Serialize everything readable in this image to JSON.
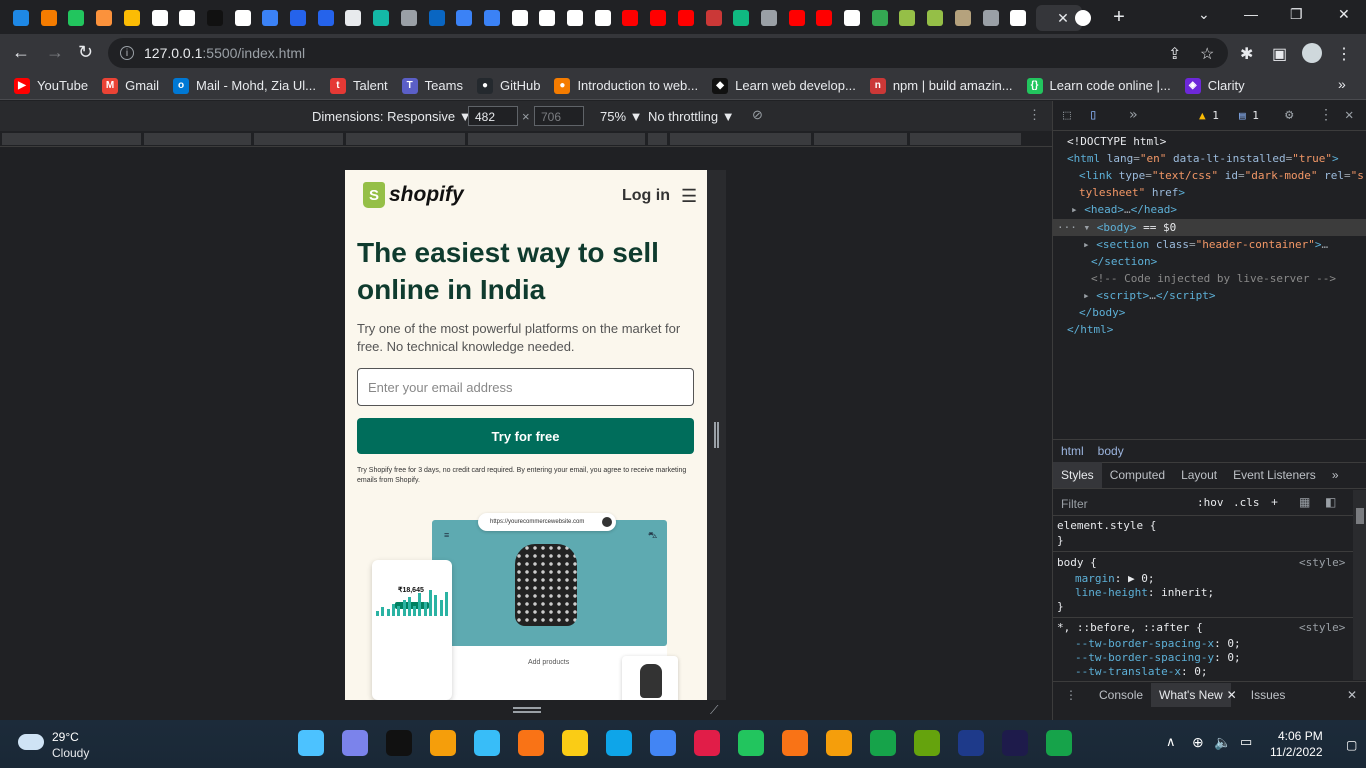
{
  "browser": {
    "tabs": [
      {
        "icon": "weather-icon",
        "color": "#1e88e5"
      },
      {
        "icon": "brave-icon",
        "color": "#f57c00"
      },
      {
        "icon": "brackets-icon",
        "color": "#22c55e"
      },
      {
        "icon": "code-icon",
        "color": "#fb923c"
      },
      {
        "icon": "keep-icon",
        "color": "#fbbc04"
      },
      {
        "icon": "google-icon",
        "color": "#ffffff"
      },
      {
        "icon": "square-icon",
        "color": "#ffffff"
      },
      {
        "icon": "figma-icon",
        "color": "#111111"
      },
      {
        "icon": "square-icon",
        "color": "#ffffff"
      },
      {
        "icon": "code-icon",
        "color": "#3b82f6"
      },
      {
        "icon": "diamond-icon",
        "color": "#2563eb"
      },
      {
        "icon": "diamond-icon",
        "color": "#2563eb"
      },
      {
        "icon": "medium-icon",
        "color": "#e8eaed"
      },
      {
        "icon": "diamond-icon",
        "color": "#14b8a6"
      },
      {
        "icon": "globe-icon",
        "color": "#9aa0a6"
      },
      {
        "icon": "linkedin-icon",
        "color": "#0a66c2"
      },
      {
        "icon": "code-icon",
        "color": "#3b82f6"
      },
      {
        "icon": "code-icon",
        "color": "#3b82f6"
      },
      {
        "icon": "github-icon",
        "color": "#ffffff"
      },
      {
        "icon": "github-icon",
        "color": "#ffffff"
      },
      {
        "icon": "github-icon",
        "color": "#ffffff"
      },
      {
        "icon": "github-icon",
        "color": "#ffffff"
      },
      {
        "icon": "youtube-icon",
        "color": "#ff0000"
      },
      {
        "icon": "youtube-icon",
        "color": "#ff0000"
      },
      {
        "icon": "youtube-icon",
        "color": "#ff0000"
      },
      {
        "icon": "npm-icon",
        "color": "#cb3837"
      },
      {
        "icon": "image-icon",
        "color": "#10b981"
      },
      {
        "icon": "globe-icon",
        "color": "#9aa0a6"
      },
      {
        "icon": "youtube-icon",
        "color": "#ff0000"
      },
      {
        "icon": "youtube-icon",
        "color": "#ff0000"
      },
      {
        "icon": "github-icon",
        "color": "#ffffff"
      },
      {
        "icon": "drive-icon",
        "color": "#34a853"
      },
      {
        "icon": "bag-icon",
        "color": "#95bf47"
      },
      {
        "icon": "bag-icon",
        "color": "#95bf47"
      },
      {
        "icon": "avatar-icon",
        "color": "#b5a27d"
      },
      {
        "icon": "globe-icon",
        "color": "#9aa0a6"
      },
      {
        "icon": "github-icon",
        "color": "#ffffff"
      }
    ],
    "active_tab_close": "✕",
    "last_tab_icon": "github-icon",
    "new_tab": "+",
    "url_host": "127.0.0.1",
    "url_path": ":5500/index.html",
    "bookmarks": [
      {
        "label": "YouTube",
        "icon": "youtube-icon",
        "color": "#ff0000",
        "glyph": "▶"
      },
      {
        "label": "Gmail",
        "icon": "gmail-icon",
        "color": "#ea4335",
        "glyph": "M"
      },
      {
        "label": "Mail - Mohd, Zia Ul...",
        "icon": "outlook-icon",
        "color": "#0078d4",
        "glyph": "o"
      },
      {
        "label": "Talent",
        "icon": "talent-icon",
        "color": "#e53935",
        "glyph": "t"
      },
      {
        "label": "Teams",
        "icon": "teams-icon",
        "color": "#5b5fc7",
        "glyph": "T"
      },
      {
        "label": "GitHub",
        "icon": "github-icon",
        "color": "#24292e",
        "glyph": "●"
      },
      {
        "label": "Introduction to web...",
        "icon": "brave-icon",
        "color": "#f57c00",
        "glyph": "●"
      },
      {
        "label": "Learn web develop...",
        "icon": "mdn-icon",
        "color": "#111111",
        "glyph": "◆"
      },
      {
        "label": "npm | build amazin...",
        "icon": "npm-icon",
        "color": "#cb3837",
        "glyph": "n"
      },
      {
        "label": "Learn code online |...",
        "icon": "brackets-icon",
        "color": "#22c55e",
        "glyph": "{}"
      },
      {
        "label": "Clarity",
        "icon": "clarity-icon",
        "color": "#6d28d9",
        "glyph": "◈"
      }
    ]
  },
  "devbar": {
    "dimensions_label": "Dimensions: Responsive",
    "width": "482",
    "height": "706",
    "zoom": "75%",
    "throttle": "No throttling"
  },
  "site": {
    "logo_text": "shopify",
    "login": "Log in",
    "hero_title": "The easiest way to sell online in India",
    "hero_subtitle": "Try one of the most powerful platforms on the market for free. No technical knowledge needed.",
    "email_placeholder": "Enter your email address",
    "cta": "Try for free",
    "disclaimer": "Try Shopify free for 3 days, no credit card required. By entering your email, you agree to receive marketing emails from Shopify.",
    "illustration": {
      "url": "https://yourecommercewebsite.com",
      "add_products": "Add products",
      "phone_total": "₹18,645",
      "phone_chart": [
        3,
        5,
        4,
        7,
        6,
        9,
        11,
        6,
        13,
        8,
        15,
        12,
        9,
        14
      ]
    }
  },
  "devtools": {
    "warnings": "1",
    "messages": "1",
    "breadcrumbs": [
      "html",
      "body"
    ],
    "subtabs": [
      "Styles",
      "Computed",
      "Layout",
      "Event Listeners"
    ],
    "filter_placeholder": "Filter",
    "hov": ":hov",
    "cls": ".cls",
    "element_style": "element.style {",
    "close_brace": "}",
    "body_selector": "body {",
    "style_source": "<style>",
    "rules_body": [
      {
        "prop": "margin",
        "value": "▶ 0;"
      },
      {
        "prop": "line-height",
        "value": "inherit;"
      }
    ],
    "universal_selector": "*, ::before, ::after {",
    "rules_universal": [
      {
        "prop": "--tw-border-spacing-x",
        "value": "0;"
      },
      {
        "prop": "--tw-border-spacing-y",
        "value": "0;"
      },
      {
        "prop": "--tw-translate-x",
        "value": "0;"
      }
    ],
    "drawer_tabs": [
      "Console",
      "What's New",
      "Issues"
    ]
  },
  "taskbar": {
    "temperature": "29°C",
    "condition": "Cloudy",
    "time": "4:06 PM",
    "date": "11/2/2022",
    "apps": [
      {
        "icon": "start-icon",
        "color": "#4cc2ff"
      },
      {
        "icon": "chat-icon",
        "color": "#7b83eb"
      },
      {
        "icon": "terminal-icon",
        "color": "#111111"
      },
      {
        "icon": "dev-icon",
        "color": "#f59e0b"
      },
      {
        "icon": "paint-icon",
        "color": "#38bdf8"
      },
      {
        "icon": "vlc-icon",
        "color": "#f97316"
      },
      {
        "icon": "explorer-icon",
        "color": "#facc15"
      },
      {
        "icon": "vscode-icon",
        "color": "#0ea5e9"
      },
      {
        "icon": "chrome-icon",
        "color": "#4285f4"
      },
      {
        "icon": "spotify-icon",
        "color": "#e11d48"
      },
      {
        "icon": "leaf-icon",
        "color": "#22c55e"
      },
      {
        "icon": "swift-icon",
        "color": "#f97316"
      },
      {
        "icon": "sublime-icon",
        "color": "#f59e0b"
      },
      {
        "icon": "android-icon",
        "color": "#16a34a"
      },
      {
        "icon": "utorrent-icon",
        "color": "#65a30d"
      },
      {
        "icon": "lrc-icon",
        "color": "#1e3a8a"
      },
      {
        "icon": "amazon-music-icon",
        "color": "#1e1b4b"
      },
      {
        "icon": "chat-green-icon",
        "color": "#16a34a"
      }
    ]
  }
}
